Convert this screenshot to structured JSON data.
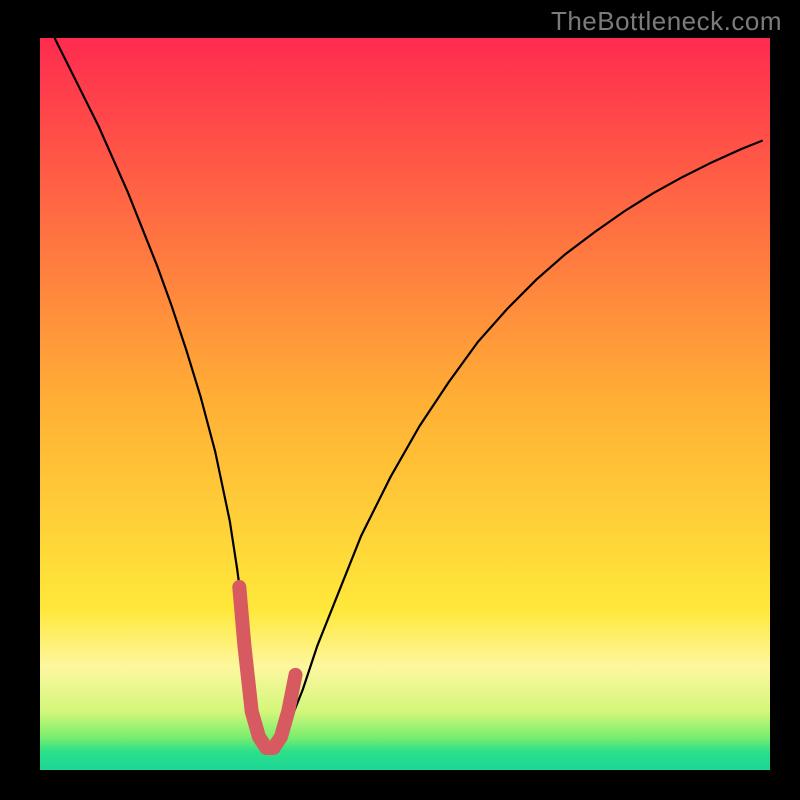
{
  "watermark": {
    "text": "TheBottleneck.com"
  },
  "chart_data": {
    "type": "line",
    "title": "",
    "xlabel": "",
    "ylabel": "",
    "xlim": [
      0,
      100
    ],
    "ylim": [
      0,
      100
    ],
    "grid": false,
    "legend": false,
    "background_gradient": {
      "stops": [
        {
          "offset": 0.0,
          "color": "#ff2b4f"
        },
        {
          "offset": 0.5,
          "color": "#ffb035"
        },
        {
          "offset": 0.78,
          "color": "#ffe83a"
        },
        {
          "offset": 0.86,
          "color": "#fdf7a0"
        },
        {
          "offset": 0.92,
          "color": "#d3f77a"
        },
        {
          "offset": 0.955,
          "color": "#7bee6e"
        },
        {
          "offset": 0.975,
          "color": "#2be08a"
        },
        {
          "offset": 1.0,
          "color": "#1cd695"
        }
      ]
    },
    "series": [
      {
        "name": "bottleneck-curve",
        "color": "#000000",
        "x": [
          2,
          4,
          6,
          8,
          10,
          12,
          14,
          16,
          18,
          20,
          22,
          24,
          26,
          27,
          28,
          29,
          30,
          31,
          32,
          34,
          36,
          38,
          40,
          44,
          48,
          52,
          56,
          60,
          64,
          68,
          72,
          76,
          80,
          84,
          88,
          92,
          96,
          99
        ],
        "y": [
          100,
          96,
          92,
          88,
          83.5,
          79,
          74,
          69,
          63.5,
          57.5,
          51,
          43.5,
          34,
          27.5,
          20,
          11,
          5.5,
          3,
          3,
          6,
          11,
          17,
          22,
          32,
          40,
          47,
          53,
          58.5,
          63,
          67,
          70.5,
          73.5,
          76.3,
          78.8,
          81,
          83,
          84.8,
          86
        ]
      },
      {
        "name": "optimal-range-highlight",
        "color": "#d65a5f",
        "x": [
          27.3,
          28,
          29,
          30,
          31,
          32,
          33,
          34,
          35
        ],
        "y": [
          25,
          17,
          8,
          4.5,
          3,
          3,
          4.5,
          8,
          13
        ]
      }
    ],
    "annotations": []
  }
}
